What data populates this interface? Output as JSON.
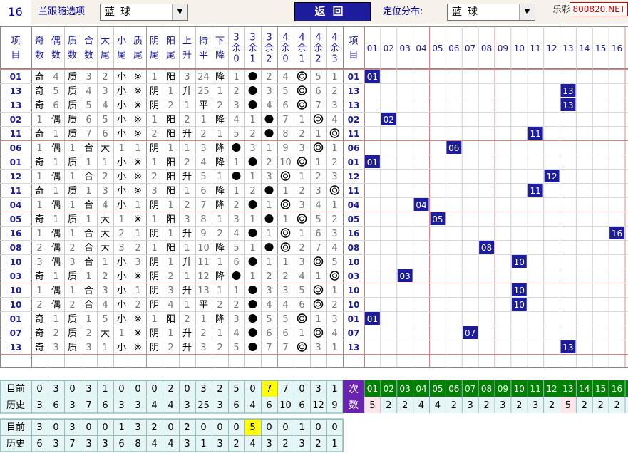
{
  "toolbar": {
    "number": "16",
    "follow_label": "兰跟随选项",
    "ball_select": "蓝球",
    "back_label": "返回",
    "position_label": "定位分布:",
    "position_select": "蓝球"
  },
  "watermark": {
    "brand": "乐彩",
    "site": "800820.NET"
  },
  "headers": [
    "项目",
    "奇数",
    "偶数",
    "质数",
    "合数",
    "大尾",
    "小尾",
    "质尾",
    "阴尾",
    "阳尾",
    "上升",
    "持平",
    "下降",
    "3余0",
    "3余1",
    "3余2",
    "4余0",
    "4余1",
    "4余2",
    "4余3",
    "项目"
  ],
  "numbers": [
    "01",
    "02",
    "03",
    "04",
    "05",
    "06",
    "07",
    "08",
    "09",
    "10",
    "11",
    "12",
    "13",
    "14",
    "15",
    "16"
  ],
  "rows": [
    [
      "01",
      "奇",
      "4",
      "质",
      "3",
      "2",
      "小",
      "※",
      "1",
      "阳",
      "3",
      "24",
      "降",
      "1",
      "●",
      "2",
      "4",
      "◎",
      "5",
      "1"
    ],
    [
      "13",
      "奇",
      "5",
      "质",
      "4",
      "3",
      "小",
      "※",
      "阴",
      "1",
      "升",
      "25",
      "1",
      "2",
      "●",
      "3",
      "5",
      "◎",
      "6",
      "2"
    ],
    [
      "13",
      "奇",
      "6",
      "质",
      "5",
      "4",
      "小",
      "※",
      "阴",
      "2",
      "1",
      "平",
      "2",
      "3",
      "●",
      "4",
      "6",
      "◎",
      "7",
      "3"
    ],
    [
      "02",
      "1",
      "偶",
      "质",
      "6",
      "5",
      "小",
      "※",
      "1",
      "阳",
      "2",
      "1",
      "降",
      "4",
      "1",
      "●",
      "7",
      "1",
      "◎",
      "4"
    ],
    [
      "11",
      "奇",
      "1",
      "质",
      "7",
      "6",
      "小",
      "※",
      "2",
      "阳",
      "升",
      "2",
      "1",
      "5",
      "2",
      "●",
      "8",
      "2",
      "1",
      "◎"
    ],
    [
      "06",
      "1",
      "偶",
      "1",
      "合",
      "大",
      "1",
      "1",
      "阴",
      "1",
      "1",
      "3",
      "降",
      "●",
      "3",
      "1",
      "9",
      "3",
      "◎",
      "1"
    ],
    [
      "01",
      "奇",
      "1",
      "质",
      "1",
      "1",
      "小",
      "※",
      "1",
      "阳",
      "2",
      "4",
      "降",
      "1",
      "●",
      "2",
      "10",
      "◎",
      "1",
      "2"
    ],
    [
      "12",
      "1",
      "偶",
      "1",
      "合",
      "2",
      "小",
      "※",
      "2",
      "阳",
      "升",
      "5",
      "1",
      "●",
      "1",
      "3",
      "◎",
      "1",
      "2",
      "3"
    ],
    [
      "11",
      "奇",
      "1",
      "质",
      "1",
      "3",
      "小",
      "※",
      "3",
      "阳",
      "1",
      "6",
      "降",
      "1",
      "2",
      "●",
      "1",
      "2",
      "3",
      "◎"
    ],
    [
      "04",
      "1",
      "偶",
      "1",
      "合",
      "4",
      "小",
      "1",
      "阴",
      "1",
      "2",
      "7",
      "降",
      "2",
      "●",
      "1",
      "◎",
      "3",
      "4",
      "1"
    ],
    [
      "05",
      "奇",
      "1",
      "质",
      "1",
      "大",
      "1",
      "※",
      "1",
      "阳",
      "3",
      "8",
      "1",
      "3",
      "1",
      "●",
      "1",
      "◎",
      "5",
      "2"
    ],
    [
      "16",
      "1",
      "偶",
      "1",
      "合",
      "大",
      "2",
      "1",
      "阴",
      "1",
      "升",
      "9",
      "2",
      "4",
      "●",
      "1",
      "◎",
      "1",
      "6",
      "3"
    ],
    [
      "08",
      "2",
      "偶",
      "2",
      "合",
      "大",
      "3",
      "2",
      "1",
      "阳",
      "1",
      "10",
      "降",
      "5",
      "1",
      "●",
      "◎",
      "2",
      "7",
      "4"
    ],
    [
      "10",
      "3",
      "偶",
      "3",
      "合",
      "1",
      "小",
      "3",
      "阴",
      "1",
      "升",
      "11",
      "1",
      "6",
      "●",
      "1",
      "1",
      "3",
      "◎",
      "5"
    ],
    [
      "03",
      "奇",
      "1",
      "质",
      "1",
      "2",
      "小",
      "※",
      "阴",
      "2",
      "1",
      "12",
      "降",
      "●",
      "1",
      "2",
      "2",
      "4",
      "1",
      "◎"
    ],
    [
      "10",
      "1",
      "偶",
      "1",
      "合",
      "3",
      "小",
      "1",
      "阴",
      "3",
      "升",
      "13",
      "1",
      "1",
      "●",
      "3",
      "3",
      "5",
      "◎",
      "1"
    ],
    [
      "10",
      "2",
      "偶",
      "2",
      "合",
      "4",
      "小",
      "2",
      "阴",
      "4",
      "1",
      "平",
      "2",
      "2",
      "●",
      "4",
      "4",
      "6",
      "◎",
      "2"
    ],
    [
      "01",
      "奇",
      "1",
      "质",
      "1",
      "5",
      "小",
      "※",
      "1",
      "阳",
      "2",
      "1",
      "降",
      "3",
      "●",
      "5",
      "5",
      "◎",
      "1",
      "3"
    ],
    [
      "07",
      "奇",
      "2",
      "质",
      "2",
      "大",
      "1",
      "※",
      "阴",
      "1",
      "升",
      "2",
      "1",
      "4",
      "●",
      "6",
      "6",
      "1",
      "◎",
      "4"
    ],
    [
      "13",
      "奇",
      "3",
      "质",
      "3",
      "1",
      "小",
      "※",
      "阴",
      "2",
      "升",
      "3",
      "2",
      "5",
      "●",
      "7",
      "7",
      "◎",
      "3",
      "1"
    ]
  ],
  "summary1": {
    "labels": [
      "目前",
      "历史"
    ],
    "current": [
      "0",
      "3",
      "0",
      "3",
      "1",
      "0",
      "0",
      "0",
      "2",
      "0",
      "3",
      "2",
      "5",
      "0",
      "7",
      "7",
      "0",
      "3",
      "1"
    ],
    "history": [
      "3",
      "6",
      "3",
      "7",
      "6",
      "3",
      "3",
      "4",
      "4",
      "3",
      "25",
      "3",
      "6",
      "4",
      "6",
      "10",
      "6",
      "12",
      "9"
    ],
    "highlight_index": 14
  },
  "summary2": {
    "labels": [
      "目前",
      "历史"
    ],
    "current": [
      "3",
      "0",
      "3",
      "0",
      "0",
      "1",
      "3",
      "2",
      "0",
      "2",
      "0",
      "0",
      "0",
      "5",
      "0",
      "0",
      "1",
      "0",
      "0"
    ],
    "history": [
      "6",
      "3",
      "7",
      "3",
      "3",
      "6",
      "8",
      "4",
      "4",
      "3",
      "1",
      "3",
      "2",
      "4",
      "3",
      "2",
      "3",
      "2",
      "1"
    ],
    "highlight_index": 13
  },
  "times": {
    "label_top": "次",
    "label_bottom": "数",
    "counts": [
      "5",
      "2",
      "2",
      "4",
      "4",
      "2",
      "3",
      "2",
      "3",
      "2",
      "3",
      "2",
      "5",
      "2",
      "2",
      "2"
    ],
    "pink_indices": [
      0,
      12
    ]
  },
  "colors": {
    "accent": "#1c1c9c",
    "red": "#c00000",
    "blue_text": "#1c1ca0",
    "gray_text": "#777777",
    "highlight": "#ffff00",
    "green": "#008000",
    "purple": "#6a22b0"
  }
}
